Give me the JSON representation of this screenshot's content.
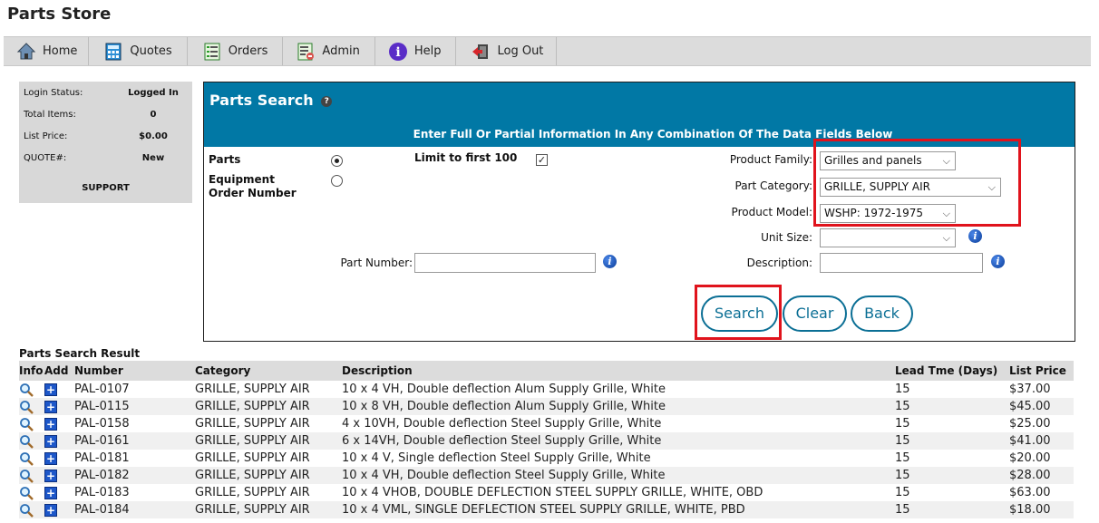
{
  "app": {
    "title": "Parts Store"
  },
  "nav": {
    "items": [
      {
        "label": "Home",
        "icon": "home-icon"
      },
      {
        "label": "Quotes",
        "icon": "calculator-icon"
      },
      {
        "label": "Orders",
        "icon": "orders-list-icon"
      },
      {
        "label": "Admin",
        "icon": "admin-icon"
      },
      {
        "label": "Help",
        "icon": "help-icon"
      },
      {
        "label": "Log Out",
        "icon": "logout-icon"
      }
    ]
  },
  "sidebar": {
    "rows": [
      {
        "label": "Login Status:",
        "value": "Logged In"
      },
      {
        "label": "Total Items:",
        "value": "0"
      },
      {
        "label": "List Price:",
        "value": "$0.00"
      },
      {
        "label": "QUOTE#:",
        "value": "New"
      }
    ],
    "support_label": "SUPPORT"
  },
  "search": {
    "title": "Parts Search",
    "subtitle": "Enter Full Or Partial Information In Any Combination Of The Data Fields Below",
    "radio_parts_label": "Parts",
    "radio_equipment_label": "Equipment Order Number",
    "limit_label": "Limit to first 100",
    "limit_checked": true,
    "product_family_label": "Product Family:",
    "product_family_value": "Grilles and panels",
    "part_category_label": "Part Category:",
    "part_category_value": "GRILLE, SUPPLY AIR",
    "product_model_label": "Product Model:",
    "product_model_value": "WSHP: 1972-1975",
    "unit_size_label": "Unit Size:",
    "unit_size_value": "",
    "part_number_label": "Part Number:",
    "part_number_value": "",
    "description_label": "Description:",
    "description_value": "",
    "search_button": "Search",
    "clear_button": "Clear",
    "back_button": "Back"
  },
  "results": {
    "title": "Parts Search Result",
    "columns": [
      "Info",
      "Add",
      "Number",
      "Category",
      "Description",
      "Lead Tme (Days)",
      "List Price"
    ],
    "rows": [
      {
        "number": "PAL-0107",
        "category": "GRILLE, SUPPLY AIR",
        "description": "10 x 4 VH, Double deflection Alum Supply Grille, White",
        "lead": "15",
        "price": "$37.00"
      },
      {
        "number": "PAL-0115",
        "category": "GRILLE, SUPPLY AIR",
        "description": "10 x 8 VH, Double deflection Alum Supply Grille, White",
        "lead": "15",
        "price": "$45.00"
      },
      {
        "number": "PAL-0158",
        "category": "GRILLE, SUPPLY AIR",
        "description": "4 x 10VH, Double deflection Steel Supply Grille, White",
        "lead": "15",
        "price": "$25.00"
      },
      {
        "number": "PAL-0161",
        "category": "GRILLE, SUPPLY AIR",
        "description": "6 x 14VH, Double deflection Steel Supply Grille, White",
        "lead": "15",
        "price": "$41.00"
      },
      {
        "number": "PAL-0181",
        "category": "GRILLE, SUPPLY AIR",
        "description": "10 x 4 V, Single deflection Steel Supply Grille, White",
        "lead": "15",
        "price": "$20.00"
      },
      {
        "number": "PAL-0182",
        "category": "GRILLE, SUPPLY AIR",
        "description": "10 x 4 VH, Double deflection Steel Supply Grille, White",
        "lead": "15",
        "price": "$28.00"
      },
      {
        "number": "PAL-0183",
        "category": "GRILLE, SUPPLY AIR",
        "description": "10 x 4 VHOB, DOUBLE DEFLECTION STEEL SUPPLY GRILLE, WHITE, OBD",
        "lead": "15",
        "price": "$63.00"
      },
      {
        "number": "PAL-0184",
        "category": "GRILLE, SUPPLY AIR",
        "description": "10 x 4 VML, SINGLE DEFLECTION STEEL SUPPLY GRILLE, WHITE, PBD",
        "lead": "15",
        "price": "$18.00"
      }
    ]
  },
  "colors": {
    "header_blue": "#0178a5",
    "highlight_red": "#e0131c",
    "button_teal": "#0b6f95"
  }
}
